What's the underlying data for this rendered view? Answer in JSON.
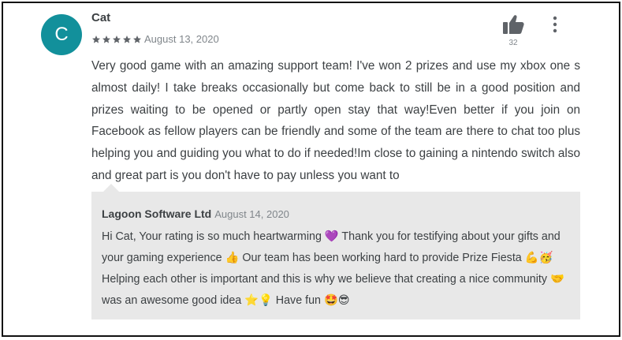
{
  "review": {
    "avatar_letter": "C",
    "author": "Cat",
    "rating": 5,
    "rating_max": 5,
    "date": "August 13, 2020",
    "helpful_count": "32",
    "text": "Very good game with an amazing support team! I've won 2 prizes and use my xbox one s almost daily! I take breaks occasionally but come back to still be in a good position and prizes waiting to be opened or partly open stay that way!Even better if you join on Facebook as fellow players can be friendly and some of the team are there to chat too plus helping you and guiding you what to do if needed!Im close to gaining a nintendo switch also and great part is you don't have to pay unless you want to"
  },
  "reply": {
    "author": "Lagoon Software Ltd",
    "date": "August 14, 2020",
    "text": "Hi Cat, Your rating is so much heartwarming 💜  Thank you for testifying about your gifts and your gaming experience 👍  Our team has been working hard to provide Prize Fiesta 💪🥳  Helping each other is important and this is why we believe that creating a nice community 🤝  was an awesome good idea ⭐💡  Have fun 🤩😎"
  },
  "colors": {
    "avatar_bg": "#12909b",
    "star": "#5f6368",
    "reply_bg": "#e8e8e8",
    "text": "#3c4043",
    "muted": "#80868b"
  },
  "icons": {
    "helpful": "thumbs-up-icon",
    "more": "more-vertical-icon",
    "rating": "star-icon"
  }
}
